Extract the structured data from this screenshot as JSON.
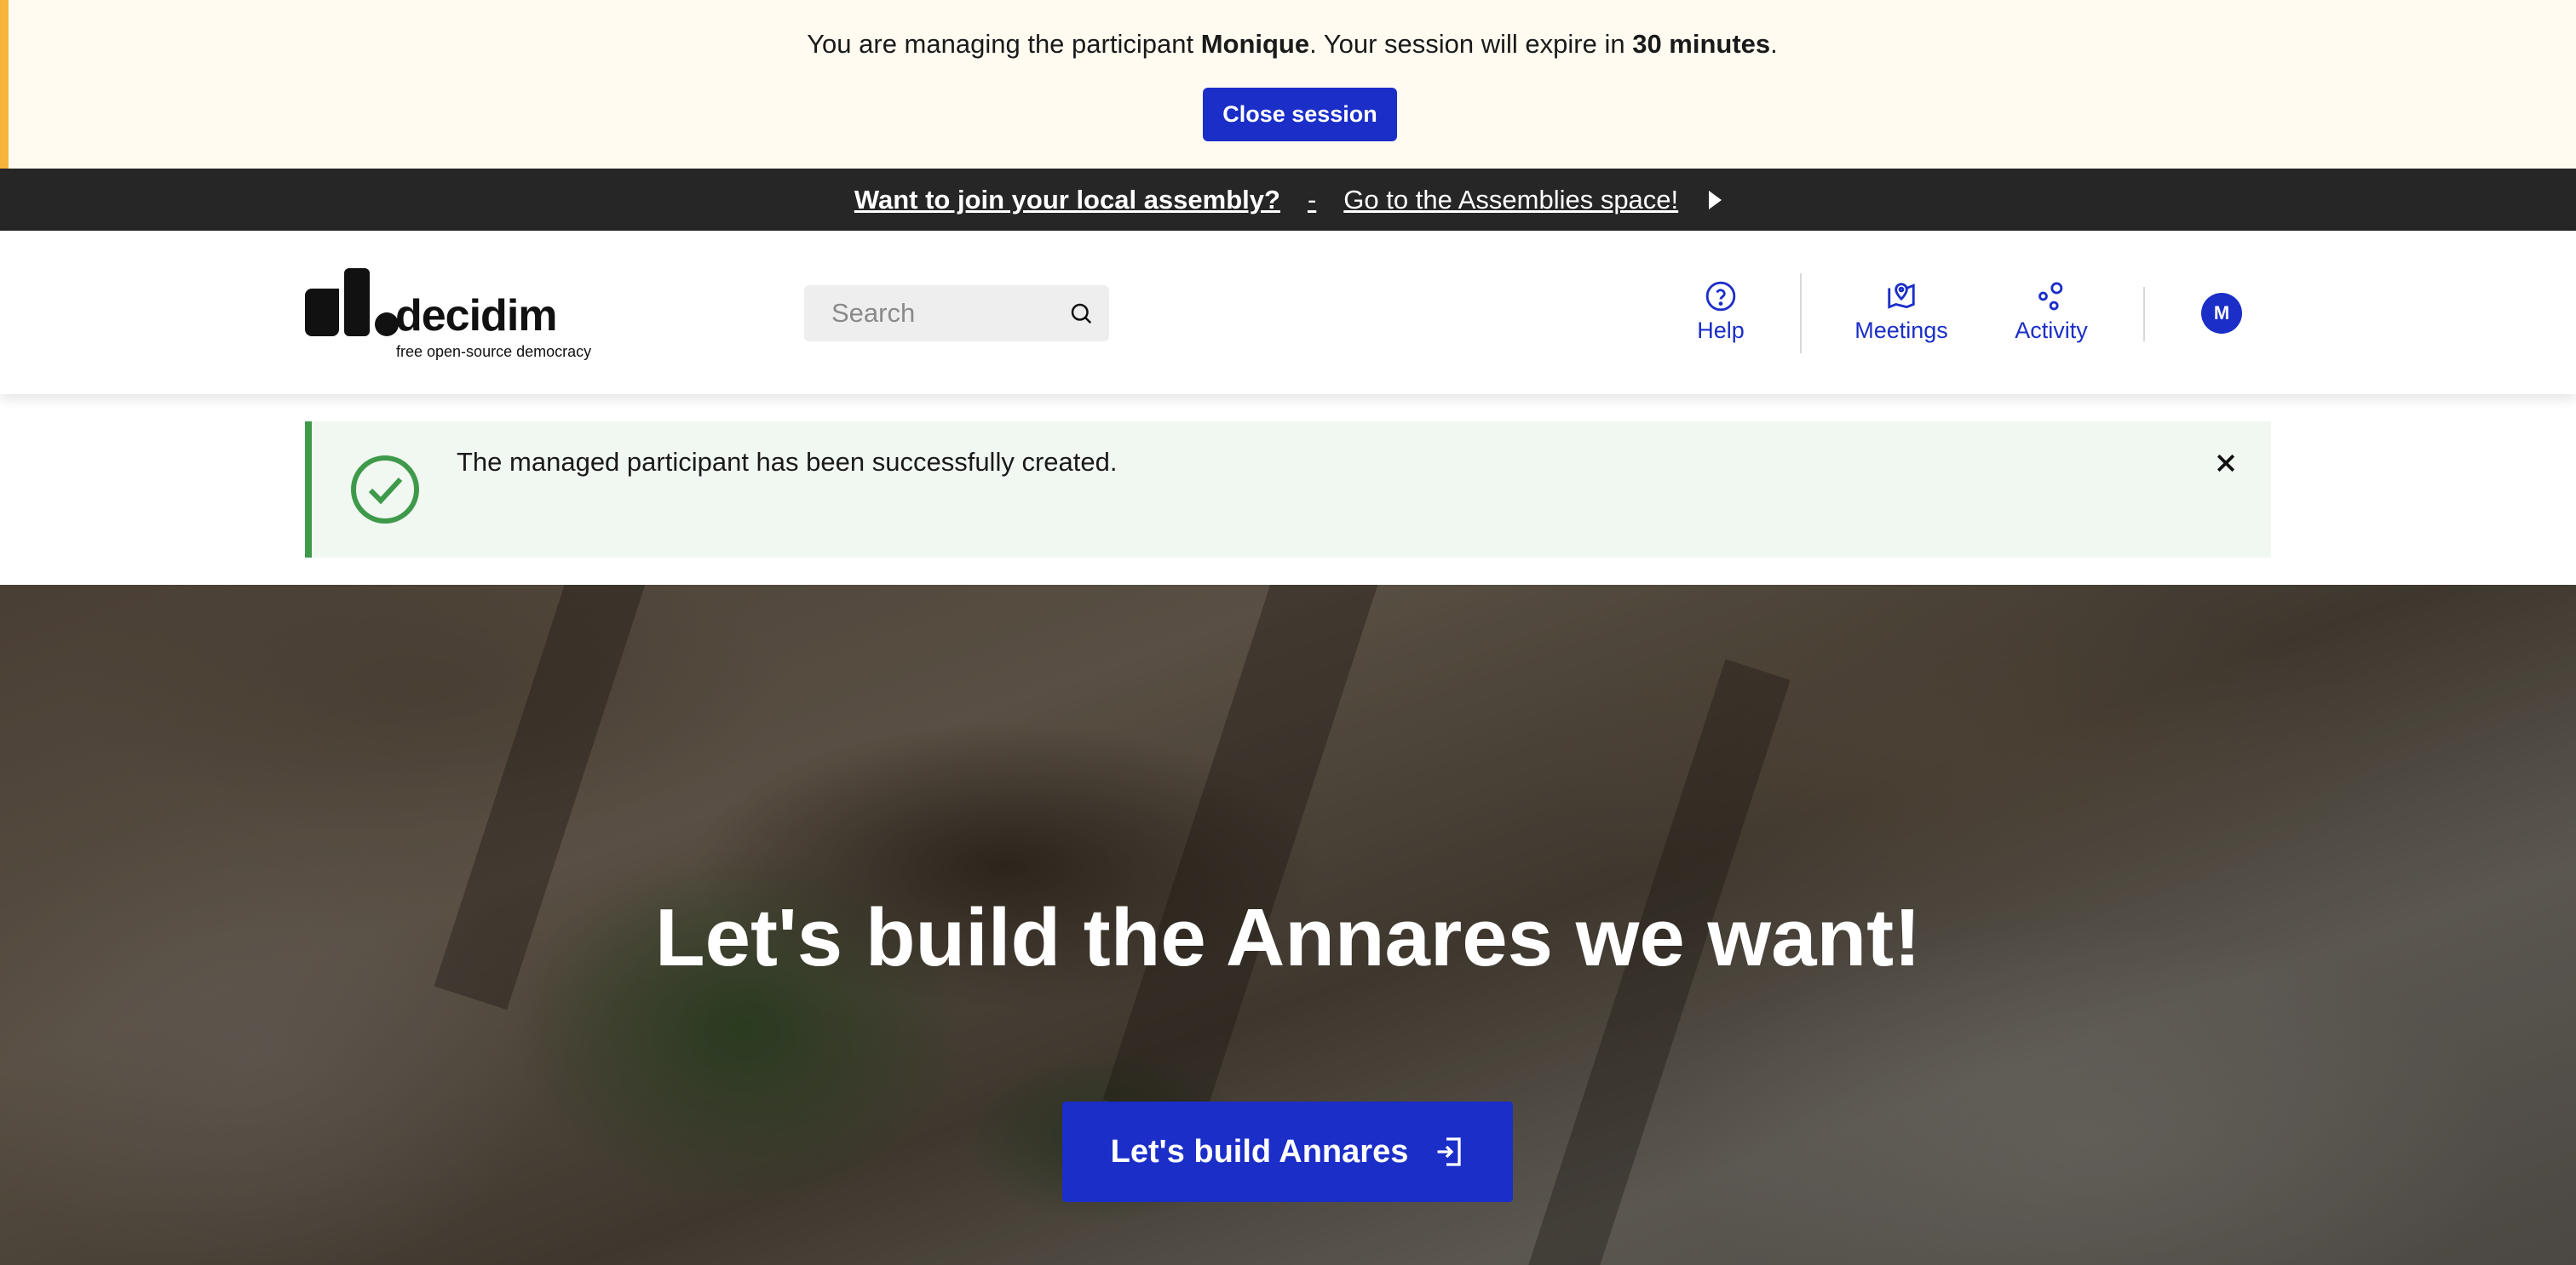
{
  "impersonation": {
    "text_before": "You are managing the participant ",
    "participant_name": "Monique",
    "text_middle": ". Your session will expire in ",
    "expiry": "30 minutes",
    "text_after": ".",
    "close_label": "Close session"
  },
  "announcement": {
    "title": "Want to join your local assembly?",
    "separator": "-",
    "link": "Go to the Assemblies space!"
  },
  "header": {
    "logo_word": "decidim",
    "logo_tagline": "free open-source democracy",
    "search_placeholder": "Search",
    "nav": [
      {
        "label": "Help",
        "icon": "help-icon"
      },
      {
        "label": "Meetings",
        "icon": "map-pin-icon"
      },
      {
        "label": "Activity",
        "icon": "activity-icon"
      }
    ],
    "avatar_initial": "M"
  },
  "flash": {
    "message": "The managed participant has been successfully created."
  },
  "hero": {
    "title": "Let's build the Annares we want!",
    "cta_label": "Let's build Annares"
  },
  "colors": {
    "primary": "#1b2ec8",
    "success": "#3e9a4a",
    "warning": "#f5b43a",
    "announcement_bg": "#262626"
  }
}
